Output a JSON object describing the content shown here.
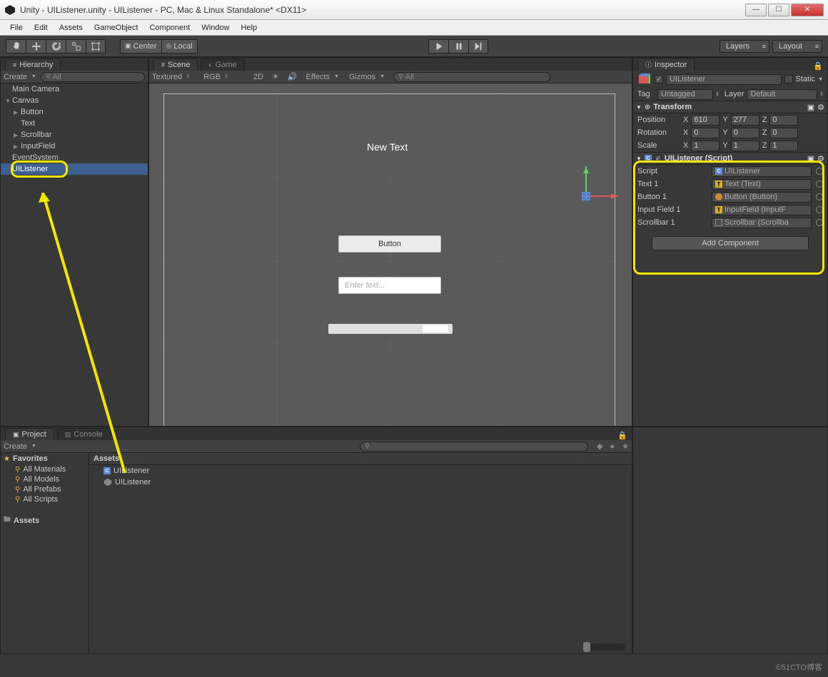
{
  "window": {
    "title": "Unity - UIListener.unity - UIListener - PC, Mac & Linux Standalone* <DX11>"
  },
  "menu": [
    "File",
    "Edit",
    "Assets",
    "GameObject",
    "Component",
    "Window",
    "Help"
  ],
  "toolbar": {
    "center": "Center",
    "local": "Local",
    "layers": "Layers",
    "layout": "Layout"
  },
  "hierarchy": {
    "tab": "Hierarchy",
    "create": "Create",
    "searchPlaceholder": "All",
    "items": [
      "Main Camera",
      "Canvas",
      "Button",
      "Text",
      "Scrollbar",
      "InputField",
      "EventSystem",
      "UIListener"
    ]
  },
  "scene": {
    "tabScene": "Scene",
    "tabGame": "Game",
    "textured": "Textured",
    "rgb": "RGB",
    "twod": "2D",
    "effects": "Effects",
    "gizmos": "Gizmos",
    "searchPlaceholder": "All",
    "newText": "New Text",
    "button": "Button",
    "inputPlaceholder": "Enter text..."
  },
  "inspector": {
    "tab": "Inspector",
    "objName": "UIListener",
    "static": "Static",
    "tagLabel": "Tag",
    "tag": "Untagged",
    "layerLabel": "Layer",
    "layer": "Default",
    "transform": {
      "title": "Transform",
      "position": "Position",
      "rotation": "Rotation",
      "scale": "Scale",
      "px": "610",
      "py": "277",
      "pz": "0",
      "rx": "0",
      "ry": "0",
      "rz": "0",
      "sx": "1",
      "sy": "1",
      "sz": "1",
      "x": "X",
      "y": "Y",
      "z": "Z"
    },
    "script": {
      "title": "UIListener (Script)",
      "scriptLabel": "Script",
      "scriptVal": "UIListener",
      "text1": "Text 1",
      "text1v": "Text (Text)",
      "button1": "Button 1",
      "button1v": "Button (Button)",
      "input1": "Input Field 1",
      "input1v": "InputField (InputF",
      "scroll1": "Scrollbar 1",
      "scroll1v": "Scrollbar (Scrollba"
    },
    "addComponent": "Add Component"
  },
  "project": {
    "tabProject": "Project",
    "tabConsole": "Console",
    "create": "Create",
    "favorites": "Favorites",
    "favItems": [
      "All Materials",
      "All Models",
      "All Prefabs",
      "All Scripts"
    ],
    "assets": "Assets",
    "assetsHeader": "Assets",
    "assetItems": [
      "UIListener",
      "UIListener"
    ]
  },
  "watermark": "©51CTO博客"
}
